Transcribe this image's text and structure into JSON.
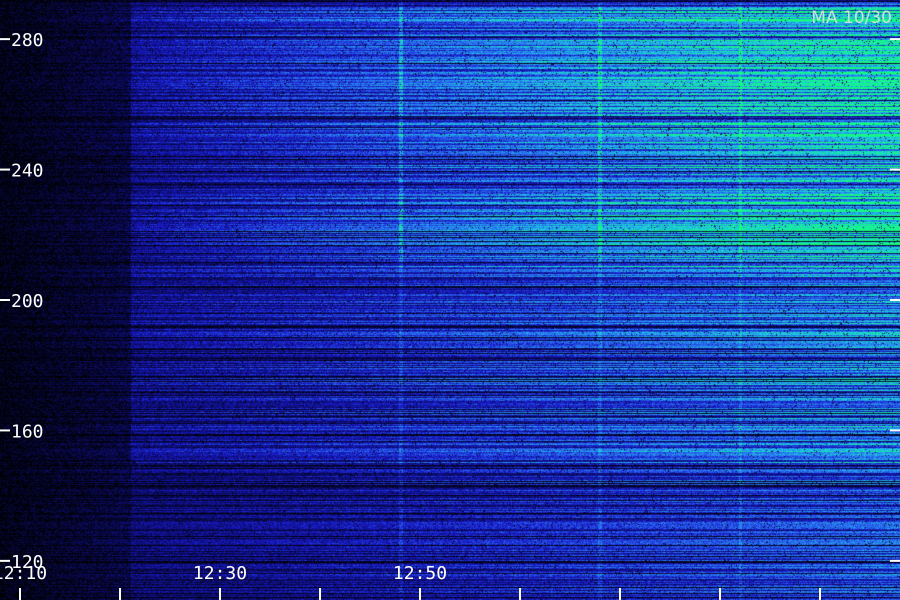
{
  "chart_data": {
    "type": "heatmap",
    "title": "",
    "station_label": "MA 10/30",
    "xlabel": "",
    "ylabel": "",
    "x_tick_labels": [
      "12:10",
      "12:30",
      "12:50"
    ],
    "x_range_minutes": [
      12.08,
      12.98
    ],
    "x_major_tick_minutes": [
      12.0,
      12.1,
      12.2,
      12.3,
      12.4,
      12.5,
      12.6,
      12.7,
      12.8,
      12.9
    ],
    "y_tick_labels": [
      "280",
      "240",
      "200",
      "160",
      "120"
    ],
    "y_tick_values": [
      280,
      240,
      200,
      160,
      120
    ],
    "y_range": [
      108,
      292
    ],
    "colormap": [
      "#000000",
      "#0a0a5a",
      "#1818c8",
      "#2a6cf0",
      "#1ec8e6",
      "#14ff78"
    ],
    "intensity_description": "low before 12:20, increasing toward 12:50; strongest at 200-290",
    "onset_time": "12:21",
    "bright_band_y": [
      210,
      290
    ],
    "vertical_bursts_minutes": [
      12.48,
      12.68,
      12.82
    ]
  }
}
